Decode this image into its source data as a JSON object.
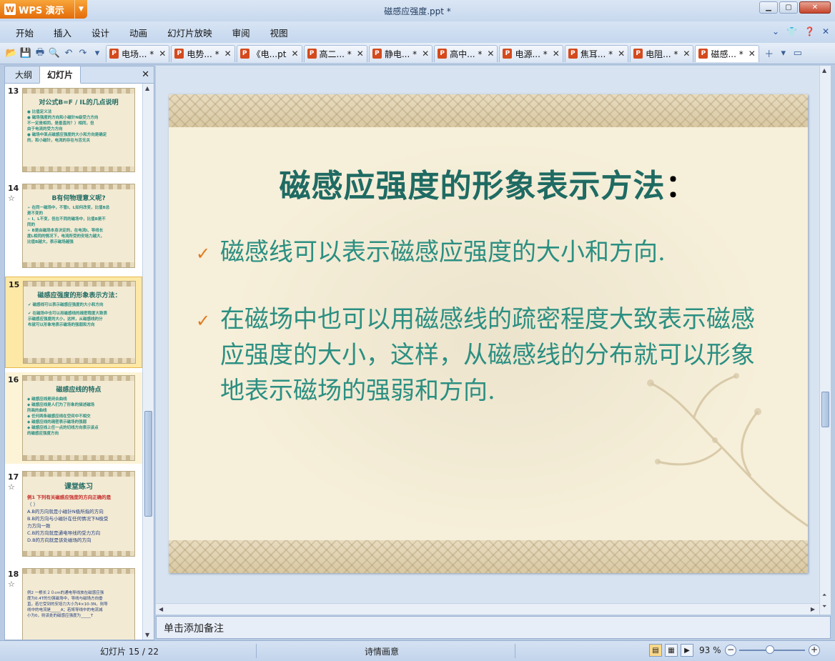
{
  "app": {
    "name": "WPS 演示",
    "window_title": "磁感应强度.ppt *"
  },
  "menu": [
    "开始",
    "插入",
    "设计",
    "动画",
    "幻灯片放映",
    "审阅",
    "视图"
  ],
  "doc_tabs": [
    {
      "label": "电场... *",
      "active": false
    },
    {
      "label": "电势... *",
      "active": false
    },
    {
      "label": "《电...pt",
      "active": false
    },
    {
      "label": "高二... *",
      "active": false
    },
    {
      "label": "静电... *",
      "active": false
    },
    {
      "label": "高中... *",
      "active": false
    },
    {
      "label": "电源... *",
      "active": false
    },
    {
      "label": "焦耳... *",
      "active": false
    },
    {
      "label": "电阻... *",
      "active": false
    },
    {
      "label": "磁感... *",
      "active": true
    }
  ],
  "panel": {
    "tab_outline": "大纲",
    "tab_slides": "幻灯片"
  },
  "thumbnails": [
    {
      "num": "13",
      "title": "对公式B=F / IL的几点说明",
      "lines": [
        "● 比值定义法",
        "● 磁场强度的方向和小磁针N级受力方向",
        "  不一定是相同，是垂直的？）相同，但",
        "  由于电流的受力方向",
        "● 磁场中某点磁感应强度的大小和方向是确定",
        "  的，和小磁针，电流的存在与否无关"
      ]
    },
    {
      "num": "14",
      "title": "B有何物理意义呢?",
      "lines": [
        "➢ 在同一磁场中，不管I、L如何改变，比值B总",
        "  是不变的",
        "➢ I、L不变，但在不同的磁场中，比值B是不",
        "  同的",
        "➢ B是由磁场本身决定的，在电流I、导线长",
        "  度L相同的情况下，电流所受的安培力越大，",
        "  比值B越大，表示磁场越强"
      ]
    },
    {
      "num": "15",
      "title": "磁感应强度的形象表示方法：",
      "lines": [
        "✔ 磁感线可以表示磁感应强度的大小和方向",
        "✔ 在磁场中也可以用磁感线的疏密程度大致表",
        "  示磁感应强度的大小，这样，从磁感线的分",
        "  布就可以形象地表示磁场的强弱和方向"
      ]
    },
    {
      "num": "16",
      "title": "磁感应线的特点",
      "lines": [
        "◆ 磁感应线是闭合曲线",
        "◆ 磁感应线是人们为了形象的描述磁场",
        "  所画的曲线",
        "◆ 任何两条磁感应线在空间中不相交",
        "◆ 磁感应线的疏密表示磁场的强弱",
        "◆ 磁感应线上任一点的切线方向表示该点",
        "  的磁感应强度方向"
      ]
    },
    {
      "num": "17",
      "title": "课堂练习",
      "lines": [
        "例1 下列有关磁感应强度的方向正确的是",
        "    （  ）",
        "A.B的方向就是小磁针N极所指的方向",
        "B.B的方向与小磁针在任何情况下N极受",
        "    力方向一致",
        "C.B的方向就是通电导线的受力方向",
        "D.B的方向就是该处磁场的方向"
      ]
    },
    {
      "num": "18",
      "title": "",
      "lines": [
        "例2 一根长２０cm的通电导线放在磁感应强",
        "  度为0.4T的匀强磁场中，导线与磁场方向垂",
        "  直，若它受到的安培力大小为4×10-3N，则导",
        "  线中的电流是_____A；若将导线中的电流减",
        "  小为0，则该处的磁感应强度为_____T"
      ]
    }
  ],
  "slide": {
    "title": "磁感应强度的形象表示方法",
    "title_colon": "：",
    "bullets": [
      "磁感线可以表示磁感应强度的大小和方向.",
      "在磁场中也可以用磁感线的疏密程度大致表示磁感应强度的大小，这样，从磁感线的分布就可以形象地表示磁场的强弱和方向."
    ],
    "bullet_glyph": "✓"
  },
  "notes_placeholder": "单击添加备注",
  "status": {
    "slide_counter": "幻灯片 15 / 22",
    "theme": "诗情画意",
    "zoom": "93 %"
  },
  "colors": {
    "title": "#1f6b63",
    "body": "#2b8f82",
    "check": "#e07a1e",
    "slide_bg": "#f6efd9"
  }
}
